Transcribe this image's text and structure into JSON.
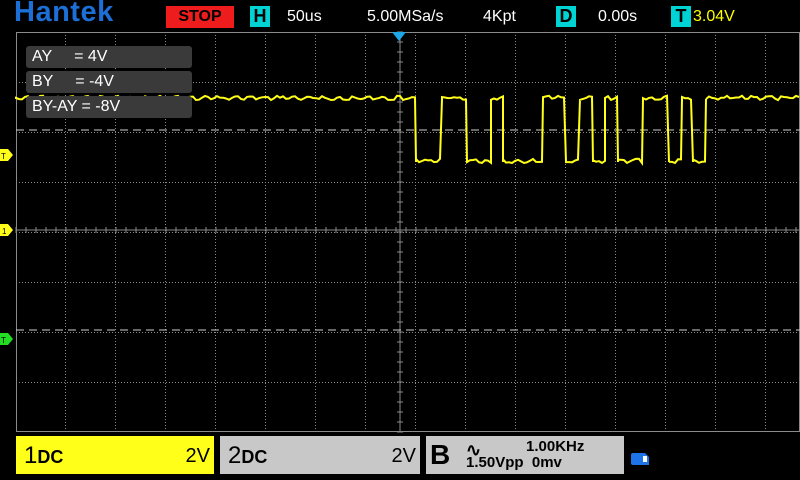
{
  "brand": "Hantek",
  "status": "STOP",
  "timebase": {
    "tag": "H",
    "value": "50us"
  },
  "sample_rate": "5.00MSa/s",
  "memory_depth": "4Kpt",
  "delay": {
    "tag": "D",
    "value": "0.00s"
  },
  "trigger": {
    "tag": "T",
    "value": "3.04V"
  },
  "cursors": [
    {
      "label": "AY     = 4V"
    },
    {
      "label": "BY     = -4V"
    },
    {
      "label": "BY-AY = -8V"
    }
  ],
  "markers": {
    "trigger_level": "T",
    "ch1": "1",
    "ch2_trigger": "T"
  },
  "channels": [
    {
      "num": "1",
      "coupling": "DC",
      "scale": "2V",
      "color": "#ffff1a"
    },
    {
      "num": "2",
      "coupling": "DC",
      "scale": "2V",
      "color": "#c8c8c8"
    }
  ],
  "generator": {
    "label": "B",
    "wave_symbol": "∿",
    "frequency": "1.00KHz",
    "vpp": "1.50Vpp",
    "offset": "0mv"
  },
  "colors": {
    "ch1_trace": "#ffff1a",
    "grid": "#8a8a8a",
    "cursor": "#d0d0d0",
    "ch2_marker": "#22dd22"
  }
}
